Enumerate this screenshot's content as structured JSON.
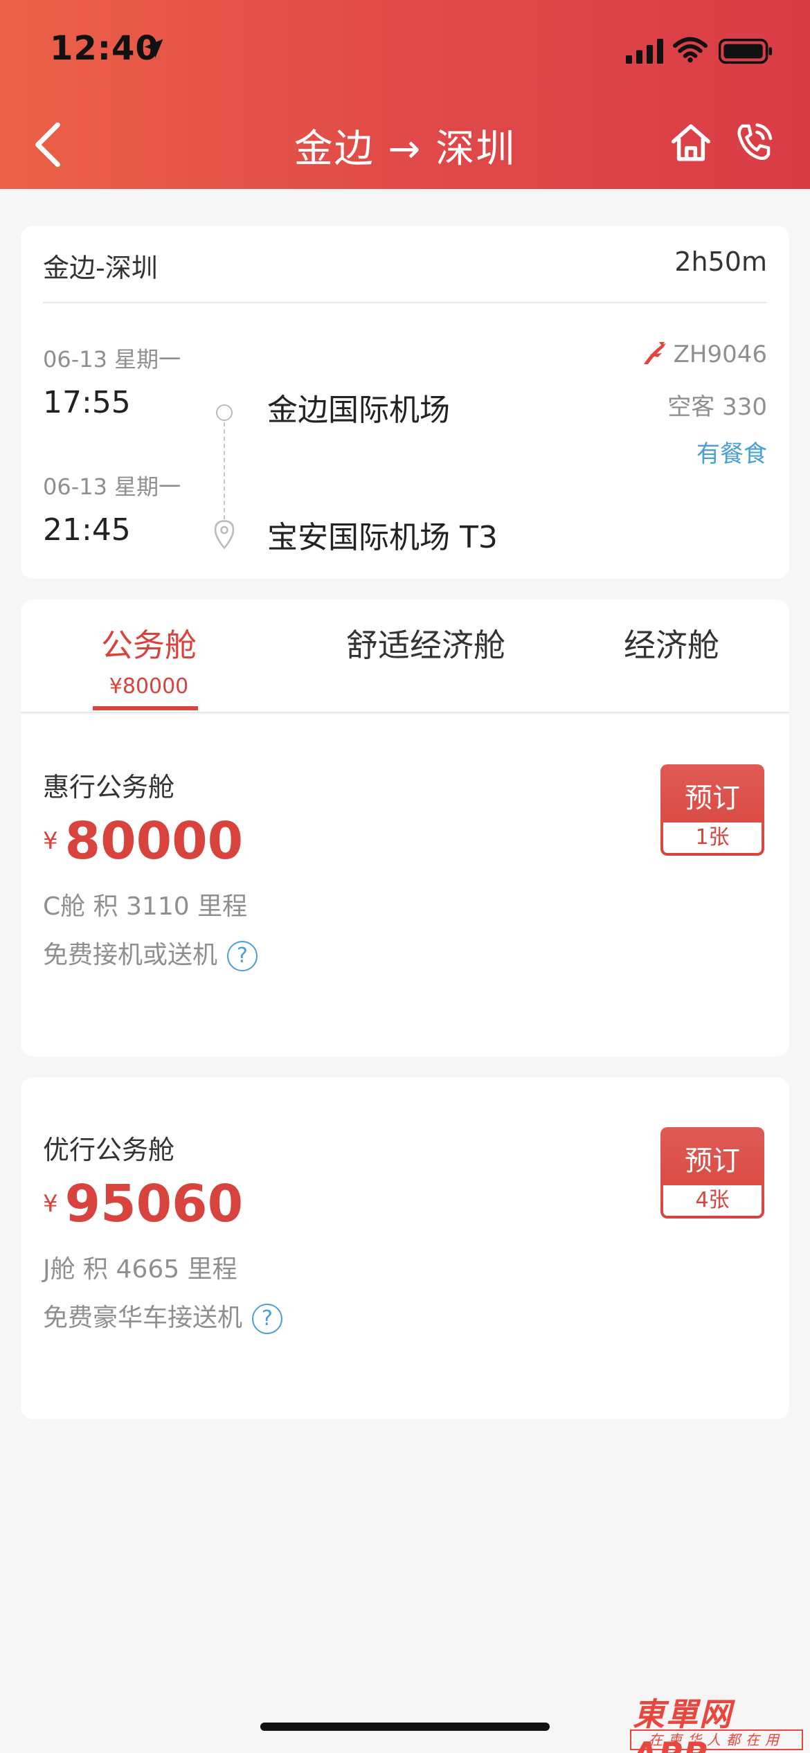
{
  "status_bar": {
    "time": "12:40"
  },
  "nav": {
    "title": "金边 → 深圳"
  },
  "flight": {
    "route": "金边-深圳",
    "duration": "2h50m",
    "departure": {
      "date": "06-13 星期一",
      "time": "17:55",
      "airport": "金边国际机场"
    },
    "arrival": {
      "date": "06-13 星期一",
      "time": "21:45",
      "airport": "宝安国际机场 T3"
    },
    "flight_number": "ZH9046",
    "aircraft": "空客 330",
    "meal": "有餐食"
  },
  "tabs": [
    {
      "label": "公务舱",
      "sub": "¥80000"
    },
    {
      "label": "舒适经济舱"
    },
    {
      "label": "经济舱"
    }
  ],
  "fares": [
    {
      "title": "惠行公务舱",
      "currency": "¥",
      "price": "80000",
      "detail": "C舱  积 3110 里程",
      "perk": "免费接机或送机",
      "book_label": "预订",
      "stock": "1张"
    },
    {
      "title": "优行公务舱",
      "currency": "¥",
      "price": "95060",
      "detail": "J舱  积 4665 里程",
      "perk": "免费豪华车接送机",
      "book_label": "预订",
      "stock": "4张"
    }
  ],
  "watermark": {
    "main": "東單网 APP",
    "sub": "在柬华人都在用"
  },
  "colors": {
    "header_start": "#ec6148",
    "header_end": "#d93c46",
    "accent": "#d8443d",
    "link": "#4a9fd6"
  }
}
